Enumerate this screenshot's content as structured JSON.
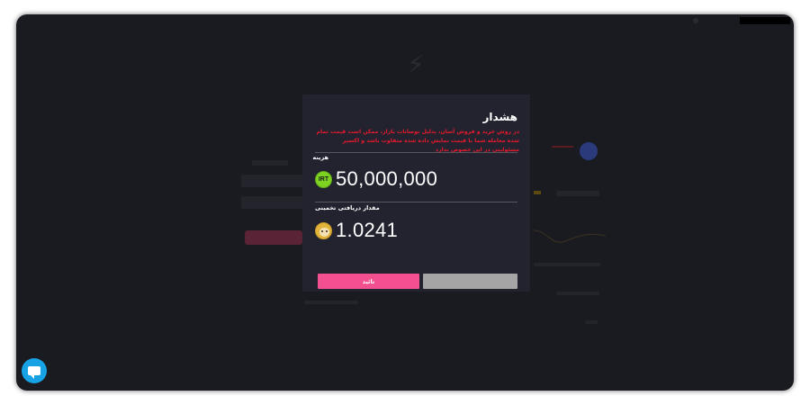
{
  "modal": {
    "title": "هشدار",
    "warning": "در روش خرید و فروش آسان، بدلیل نوسانات بازار، ممکن است قیمت تمام شده معامله شما با قیمت نمایش داده شده متفاوت باشد و اکسپر مسئولیتی در این خصوص ندارد",
    "cost_label": "هزینه",
    "cost_currency": "IRT",
    "cost_value": "50,000,000",
    "receive_label": "مقدار دریافتی تخمینی",
    "receive_value": "1.0241",
    "receive_coin_icon": "doge-coin-icon",
    "confirm_label": "تائید",
    "cancel_label": ""
  },
  "colors": {
    "confirm": "#f2508f",
    "cancel": "#a5a5a5",
    "warning": "#e8192c",
    "irt_coin": "#7ed321",
    "chat": "#17a2e5"
  },
  "chat": {
    "icon": "chat-bubble-icon"
  }
}
